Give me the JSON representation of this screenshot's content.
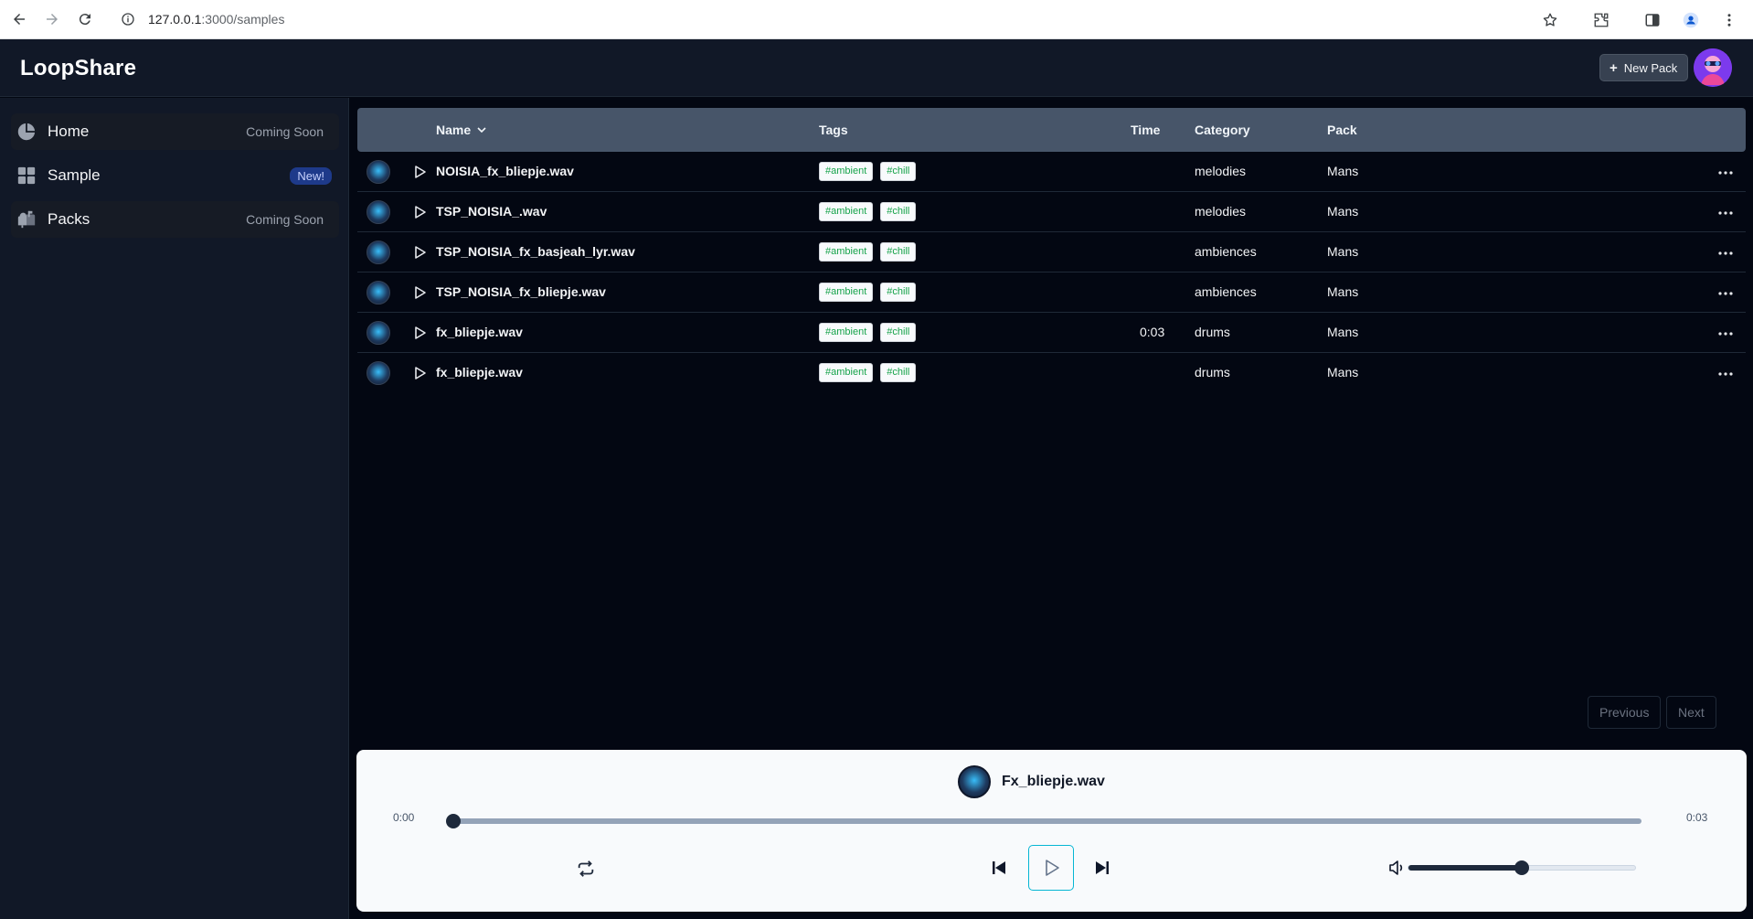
{
  "browser": {
    "url_host": "127.0.0.1",
    "url_path": ":3000/samples"
  },
  "header": {
    "brand": "LoopShare",
    "new_pack_label": "New Pack"
  },
  "sidebar": {
    "items": [
      {
        "label": "Home",
        "badge": "Coming Soon",
        "icon": "pie-chart-icon"
      },
      {
        "label": "Sample",
        "badge": "New!",
        "icon": "grid-icon"
      },
      {
        "label": "Packs",
        "badge": "Coming Soon",
        "icon": "mailbox-icon"
      }
    ]
  },
  "table": {
    "columns": {
      "name": "Name",
      "tags": "Tags",
      "time": "Time",
      "category": "Category",
      "pack": "Pack"
    },
    "rows": [
      {
        "name": "NOISIA_fx_bliepje.wav",
        "tags": [
          "#ambient",
          "#chill"
        ],
        "time": "",
        "category": "melodies",
        "pack": "Mans"
      },
      {
        "name": "TSP_NOISIA_.wav",
        "tags": [
          "#ambient",
          "#chill"
        ],
        "time": "",
        "category": "melodies",
        "pack": "Mans"
      },
      {
        "name": "TSP_NOISIA_fx_basjeah_lyr.wav",
        "tags": [
          "#ambient",
          "#chill"
        ],
        "time": "",
        "category": "ambiences",
        "pack": "Mans"
      },
      {
        "name": "TSP_NOISIA_fx_bliepje.wav",
        "tags": [
          "#ambient",
          "#chill"
        ],
        "time": "",
        "category": "ambiences",
        "pack": "Mans"
      },
      {
        "name": "fx_bliepje.wav",
        "tags": [
          "#ambient",
          "#chill"
        ],
        "time": "0:03",
        "category": "drums",
        "pack": "Mans"
      },
      {
        "name": "fx_bliepje.wav",
        "tags": [
          "#ambient",
          "#chill"
        ],
        "time": "",
        "category": "drums",
        "pack": "Mans"
      }
    ]
  },
  "pagination": {
    "previous": "Previous",
    "next": "Next"
  },
  "player": {
    "title": "Fx_bliepje.wav",
    "current_time": "0:00",
    "duration": "0:03",
    "progress": 0,
    "volume": 0.5
  }
}
